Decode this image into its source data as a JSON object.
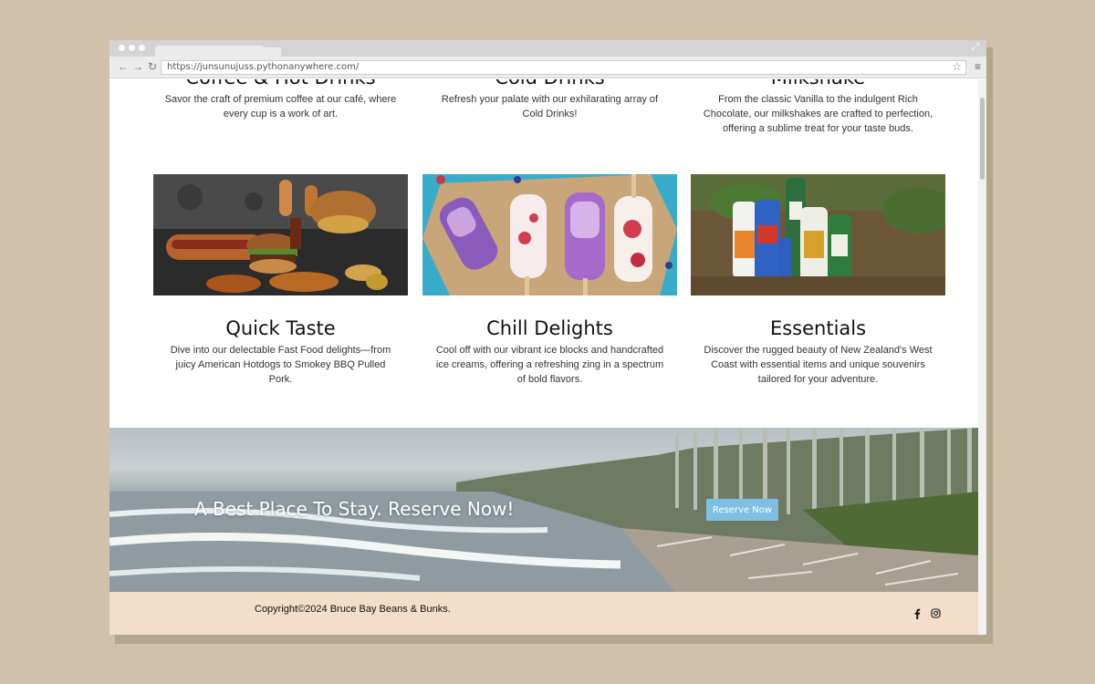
{
  "browser": {
    "url": "https://junsunujuss.pythonanywhere.com/",
    "back_icon": "arrow-left-icon",
    "forward_icon": "arrow-right-icon",
    "reload_icon": "reload-icon"
  },
  "top_cards": [
    {
      "title": "Coffee & Hot Drinks",
      "text": "Savor the craft of premium coffee at our café, where every cup is a work of art."
    },
    {
      "title": "Cold Drinks",
      "text": "Refresh your palate with our exhilarating array of Cold Drinks!"
    },
    {
      "title": "Milkshake",
      "text": "From the classic Vanilla to the indulgent Rich Chocolate, our milkshakes are crafted to perfection, offering a sublime treat for your taste buds."
    }
  ],
  "bottom_cards": [
    {
      "title": "Quick Taste",
      "text": "Dive into our delectable Fast Food delights—from juicy American Hotdogs to Smokey BBQ Pulled Pork."
    },
    {
      "title": "Chill Delights",
      "text": "Cool off with our vibrant ice blocks and handcrafted ice creams, offering a refreshing zing in a spectrum of bold flavors."
    },
    {
      "title": "Essentials",
      "text": "Discover the rugged beauty of New Zealand's West Coast with essential items and unique souvenirs tailored for your adventure."
    }
  ],
  "banner": {
    "title": "A Best Place To Stay. Reserve Now!",
    "button": "Reserve Now"
  },
  "footer": {
    "copyright": "Copyright©2024 Bruce Bay Beans & Bunks.",
    "social_icons": [
      "facebook-icon",
      "instagram-icon"
    ]
  },
  "colors": {
    "page_background": "#d0c2aa",
    "footer_background": "#f2dec9",
    "button": "#7ec0e4"
  }
}
